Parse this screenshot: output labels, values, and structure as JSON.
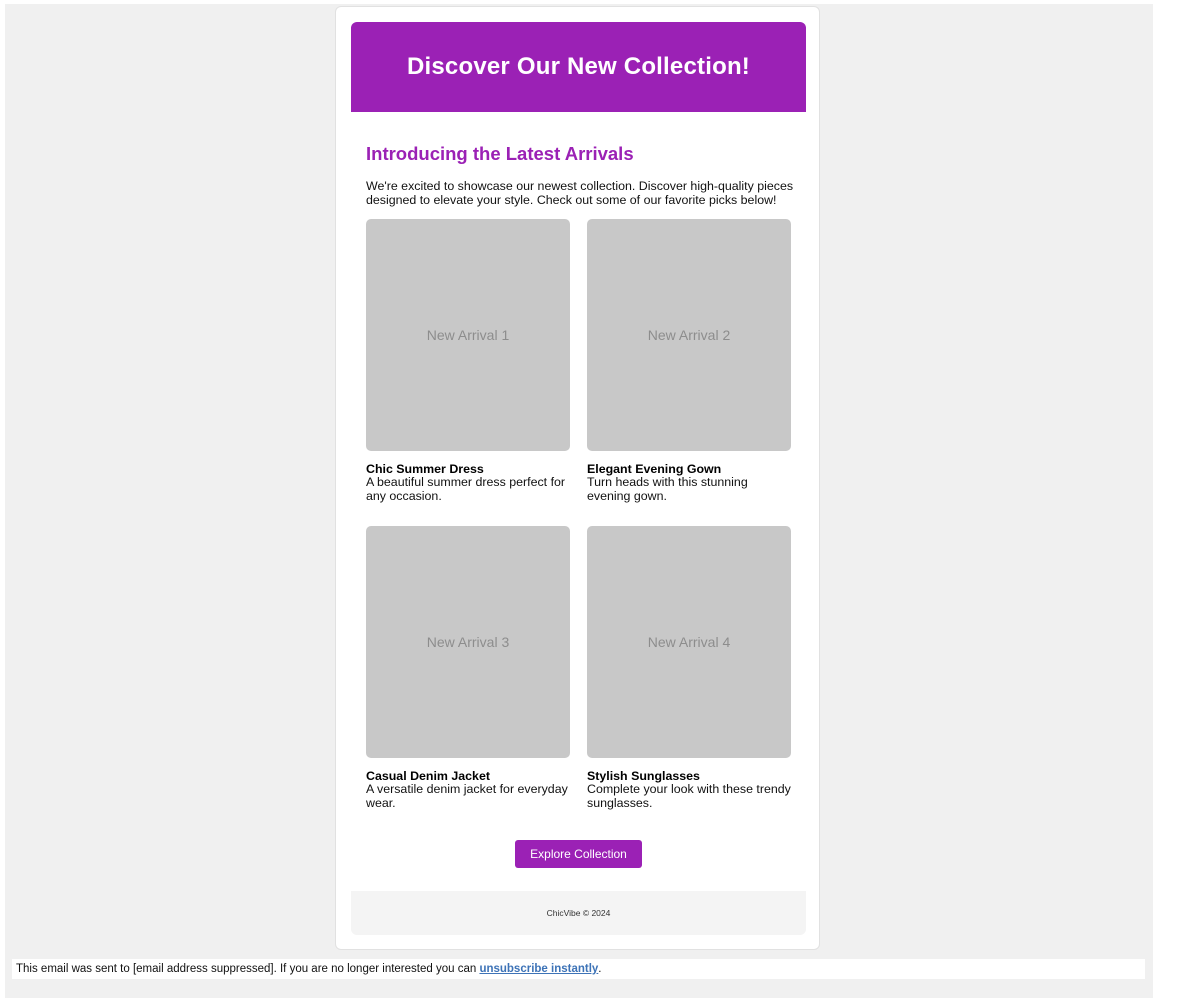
{
  "email": {
    "hero_title": "Discover Our New Collection!",
    "section_title": "Introducing the Latest Arrivals",
    "intro_text": "We're excited to showcase our newest collection. Discover high-quality pieces designed to elevate your style. Check out some of our favorite picks below!",
    "products": [
      {
        "image_label": "New Arrival 1",
        "name": "Chic Summer Dress",
        "description": "A beautiful summer dress perfect for any occasion."
      },
      {
        "image_label": "New Arrival 2",
        "name": "Elegant Evening Gown",
        "description": "Turn heads with this stunning evening gown."
      },
      {
        "image_label": "New Arrival 3",
        "name": "Casual Denim Jacket",
        "description": "A versatile denim jacket for everyday wear."
      },
      {
        "image_label": "New Arrival 4",
        "name": "Stylish Sunglasses",
        "description": "Complete your look with these trendy sunglasses."
      }
    ],
    "cta_label": "Explore Collection",
    "footer_text": "ChicVibe © 2024"
  },
  "notice": {
    "prefix": "This email was sent to [email address suppressed]. If you are no longer interested you can ",
    "link_text": "unsubscribe instantly",
    "suffix": "."
  },
  "colors": {
    "brand_purple": "#9b21b5",
    "image_placeholder": "#c8c8c8",
    "page_background": "#f0f0f0",
    "footer_background": "#f4f4f4",
    "link_blue": "#3d73b7"
  }
}
